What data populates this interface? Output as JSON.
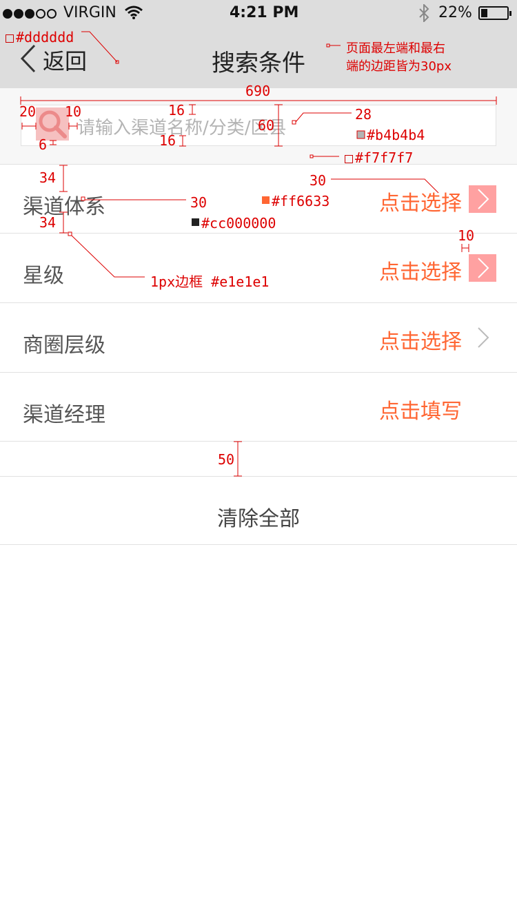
{
  "status_bar": {
    "carrier": "VIRGIN",
    "time": "4:21 PM",
    "battery": "22%"
  },
  "nav": {
    "back_label": "返回",
    "title": "搜索条件"
  },
  "search": {
    "placeholder": "请输入渠道名称/分类/区县"
  },
  "rows": [
    {
      "label": "渠道体系",
      "action": "点击选择",
      "arrow": true
    },
    {
      "label": "星级",
      "action": "点击选择",
      "arrow": true
    },
    {
      "label": "商圈层级",
      "action": "点击选择",
      "arrow": true
    },
    {
      "label": "渠道经理",
      "action": "点击填写",
      "arrow": false
    }
  ],
  "clear_label": "清除全部",
  "colors": {
    "nav_bg": "#dddddd",
    "page_bg": "#f7f7f7",
    "accent": "#ff6633",
    "placeholder": "#b4b4b4",
    "border": "#e1e1e1",
    "label": "#cc000000"
  },
  "annotations": {
    "nav_color": "#dddddd",
    "margin_note_line1": "页面最左端和最右",
    "margin_note_line2": "端的边距皆为30px",
    "width_690": "690",
    "pad_20": "20",
    "gap_10": "10",
    "pad_16_top": "16",
    "pad_16_bottom": "16",
    "height_60": "60",
    "font_28": "28",
    "pad_6": "6",
    "placeholder_color": "#b4b4b4",
    "bg_color": "#f7f7f7",
    "pad_34_top": "34",
    "pad_34_bottom": "34",
    "font_30_label": "30",
    "font_30_action": "30",
    "accent_color": "#ff6633",
    "label_color": "#cc000000",
    "arrow_gap_10": "10",
    "border_note": "1px边框 #e1e1e1",
    "gap_50": "50"
  }
}
